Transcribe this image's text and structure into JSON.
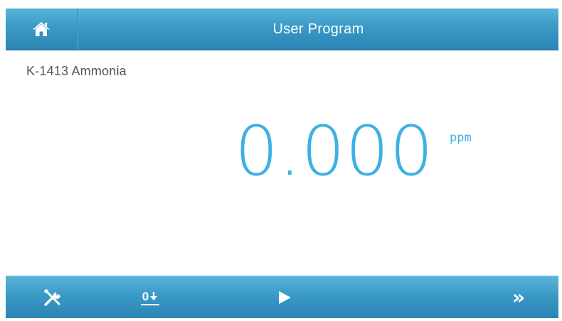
{
  "header": {
    "title": "User Program",
    "home_icon": "home-icon"
  },
  "program": {
    "name": "K-1413 Ammonia"
  },
  "reading": {
    "value": "0.000",
    "unit": "ppm"
  },
  "toolbar": {
    "tools_icon": "tools-icon",
    "zero_label": "0",
    "zero_icon": "arrow-down-icon",
    "play_icon": "play-icon",
    "next_label": "»"
  },
  "colors": {
    "bar_blue": "#3a9ac6",
    "reading_blue": "#3fb0e3",
    "text_gray": "#555555",
    "background": "#ffffff"
  }
}
